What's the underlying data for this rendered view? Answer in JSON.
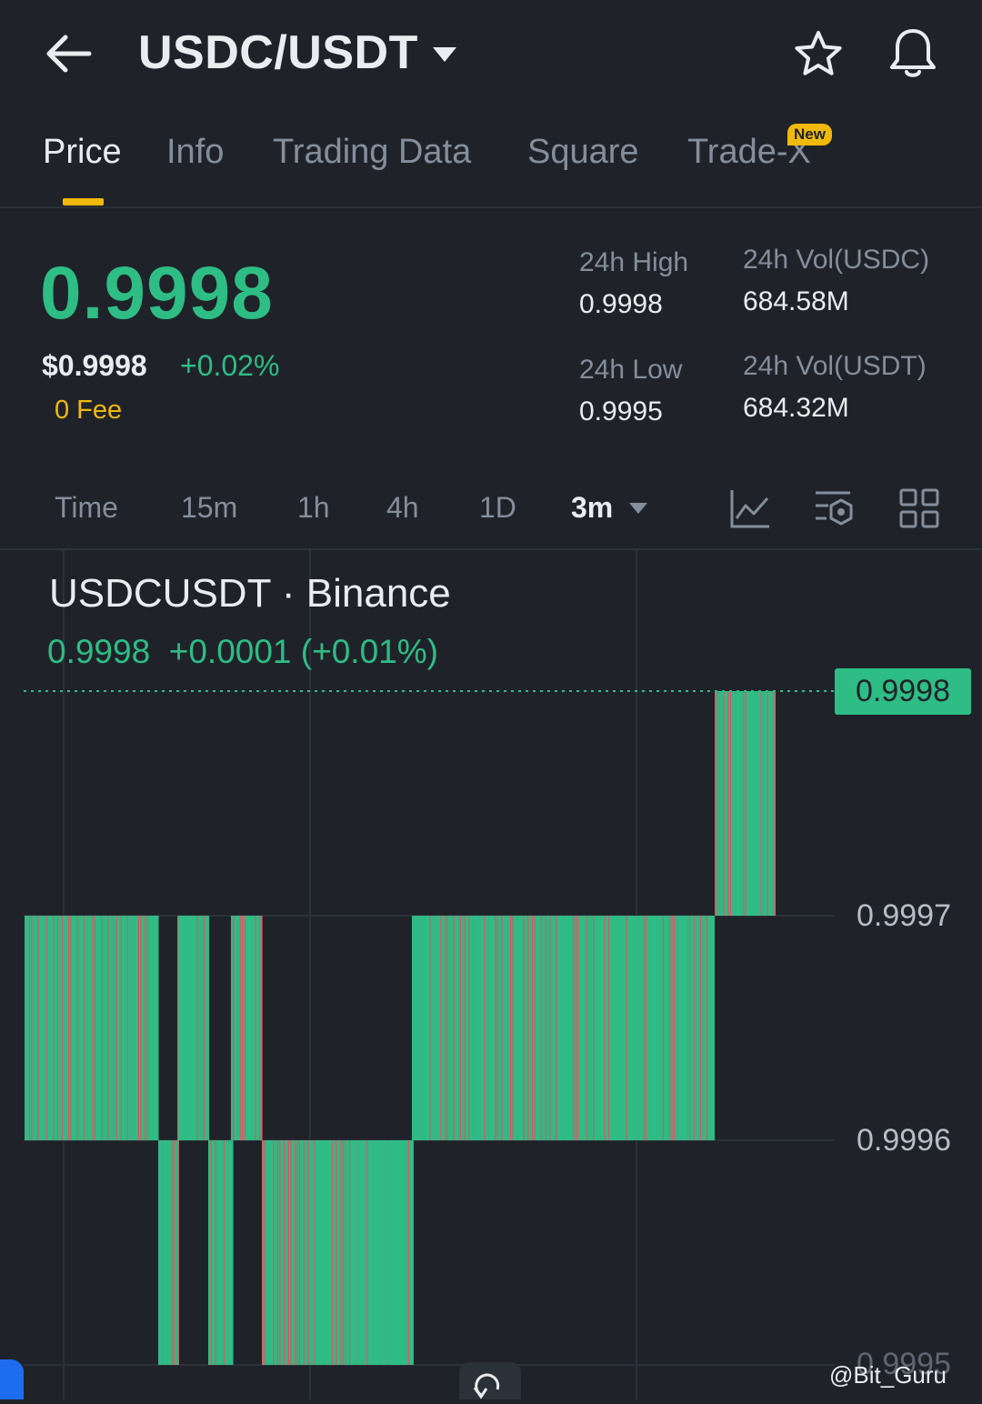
{
  "header": {
    "title": "USDC/USDT"
  },
  "tabs": [
    {
      "label": "Price",
      "active": true
    },
    {
      "label": "Info"
    },
    {
      "label": "Trading Data"
    },
    {
      "label": "Square"
    },
    {
      "label": "Trade-X"
    }
  ],
  "badge": {
    "new": "New"
  },
  "price": {
    "last": "0.9998",
    "usd": "$0.9998",
    "change": "+0.02%",
    "fee": "0 Fee"
  },
  "stats": {
    "high_label": "24h High",
    "high_value": "0.9998",
    "low_label": "24h Low",
    "low_value": "0.9995",
    "vol_usdc_label": "24h Vol(USDC)",
    "vol_usdc_value": "684.58M",
    "vol_usdt_label": "24h Vol(USDT)",
    "vol_usdt_value": "684.32M"
  },
  "intervals": [
    {
      "label": "Time"
    },
    {
      "label": "15m"
    },
    {
      "label": "1h"
    },
    {
      "label": "4h"
    },
    {
      "label": "1D"
    },
    {
      "label": "3m",
      "active": true
    }
  ],
  "chart_header": {
    "symbol": "USDCUSDT · Binance",
    "quote": "0.9998  +0.0001 (+0.01%)"
  },
  "watermark": "@Bit_Guru",
  "colors": {
    "background": "#1f2329",
    "up": "#2ebd85",
    "down": "#f6465d",
    "accent": "#f0b90b",
    "muted": "#848e9c"
  },
  "chart_data": {
    "type": "bar",
    "y_ticks": [
      "0.9998",
      "0.9997",
      "0.9996",
      "0.9995"
    ],
    "last_price_tag": "0.9998",
    "ylim": [
      0.9995,
      0.9998
    ],
    "segments": [
      {
        "low": 0.9996,
        "high": 0.9997
      },
      {
        "low": 0.9995,
        "high": 0.9996
      },
      {
        "low": 0.9996,
        "high": 0.9997
      },
      {
        "low": 0.9995,
        "high": 0.9996
      },
      {
        "low": 0.9996,
        "high": 0.9997
      },
      {
        "low": 0.9995,
        "high": 0.9996
      },
      {
        "low": 0.9996,
        "high": 0.9997
      },
      {
        "low": 0.9997,
        "high": 0.9998
      }
    ]
  }
}
